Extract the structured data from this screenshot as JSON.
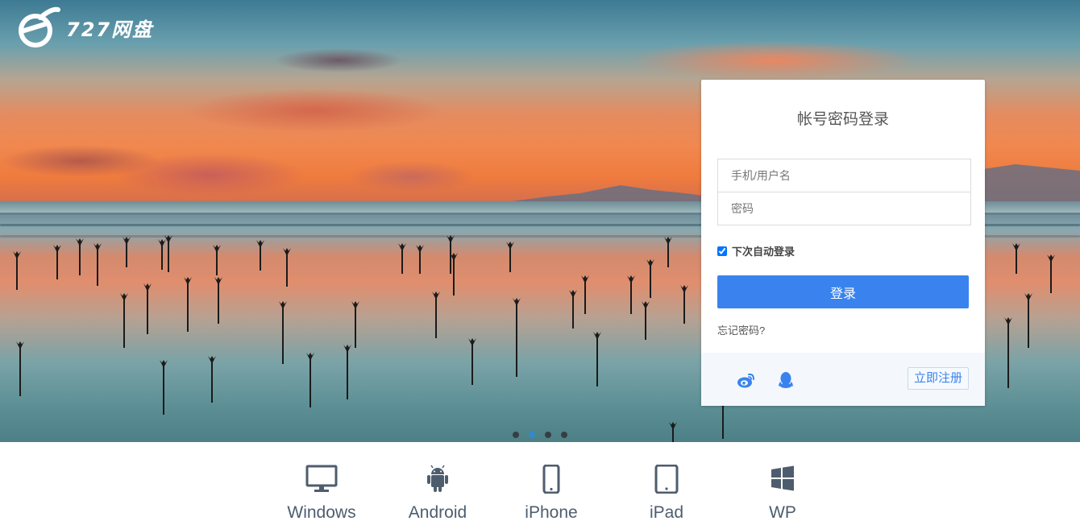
{
  "brand": {
    "name": "727网盘"
  },
  "login": {
    "title": "帐号密码登录",
    "username_placeholder": "手机/用户名",
    "password_placeholder": "密码",
    "remember_label": "下次自动登录",
    "remember_checked": true,
    "submit_label": "登录",
    "forgot_label": "忘记密码?",
    "register_label": "立即注册",
    "social": [
      "weibo-icon",
      "qq-icon"
    ]
  },
  "carousel": {
    "count": 4,
    "active_index": 1
  },
  "platforms": [
    {
      "label": "Windows",
      "icon": "monitor-icon"
    },
    {
      "label": "Android",
      "icon": "android-icon"
    },
    {
      "label": "iPhone",
      "icon": "phone-icon"
    },
    {
      "label": "iPad",
      "icon": "tablet-icon"
    },
    {
      "label": "WP",
      "icon": "windows-logo-icon"
    }
  ],
  "colors": {
    "accent": "#3a83ee",
    "active_dot": "#2b8bd9",
    "platform_text": "#4e5d6e"
  }
}
